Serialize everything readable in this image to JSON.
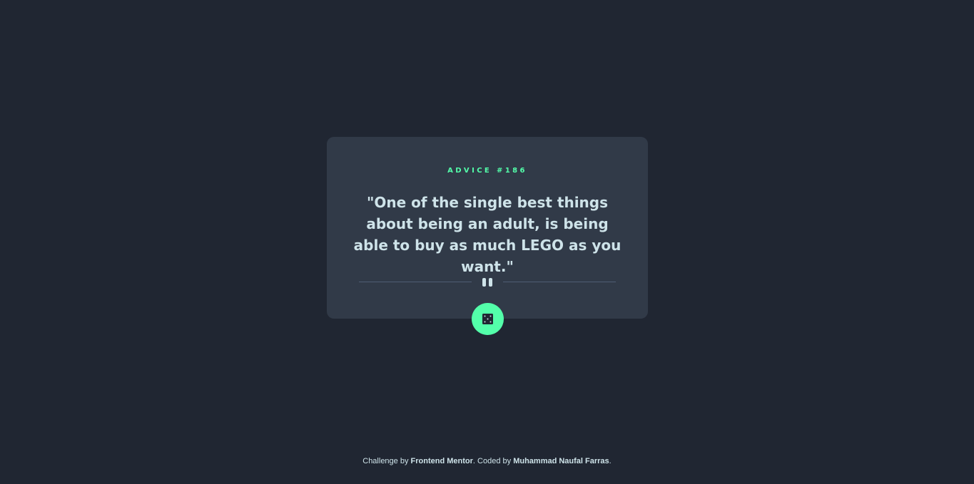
{
  "advice": {
    "id_label": "ADVICE #186",
    "text": "\"One of the single best things about being an adult, is being able to buy as much LEGO as you want.\""
  },
  "dice_button": {
    "icon": "dice-icon",
    "accent_color": "#53FFAA"
  },
  "divider": {
    "icon": "pause-icon"
  },
  "attribution": {
    "prefix": "Challenge by ",
    "challenge_link": "Frontend Mentor",
    "middle": ". Coded by ",
    "author_link": "Muhammad Naufal Farras",
    "suffix": "."
  },
  "colors": {
    "background": "#202632",
    "card": "#313A48",
    "text": "#CEE3E9",
    "accent": "#53FFAA",
    "divider": "#4F5D74"
  }
}
